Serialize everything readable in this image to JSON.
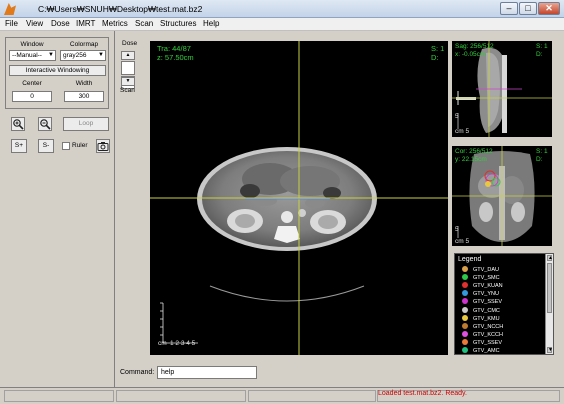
{
  "window": {
    "title": "C:₩Users₩SNUH₩Desktop₩test.mat.bz2",
    "minimize": "–",
    "maximize": "□",
    "close": "✕"
  },
  "menu": [
    "File",
    "View",
    "Dose",
    "IMRT",
    "Metrics",
    "Scan",
    "Structures",
    "Help"
  ],
  "left_panel": {
    "window_label": "Window",
    "colormap_label": "Colormap",
    "window_value": "--Manual--",
    "colormap_value": "gray256",
    "interactive_windowing": "Interactive Windowing",
    "center_label": "Center",
    "width_label": "Width",
    "center_value": "0",
    "width_value": "300",
    "loop_label": "Loop",
    "splus_label": "S+",
    "sminus_label": "S-",
    "ruler_label": "Ruler"
  },
  "dose_panel": {
    "dose_label": "Dose",
    "scan_label": "Scan"
  },
  "axial_view": {
    "line1": "Tra: 44/87",
    "line2": "z: 57.50cm",
    "right1": "S: 1",
    "right2": "D:",
    "scale_unit": "cm",
    "scale_ticks": "1 2 3 4 5"
  },
  "sagittal_view": {
    "line1": "Sag: 256/512",
    "line2": "x: -0.05cm",
    "right1": "S: 1",
    "right2": "D:",
    "scale_label": "5",
    "scale_unit": "cm 5"
  },
  "coronal_view": {
    "line1": "Cor: 256/512",
    "line2": "y: 22.15cm",
    "right1": "S: 1",
    "right2": "D:",
    "scale_label": "5",
    "scale_unit": "cm 5"
  },
  "legend": {
    "title": "Legend",
    "items": [
      {
        "label": "GTV_DAU",
        "color": "#d9a24a"
      },
      {
        "label": "GTV_SMC",
        "color": "#2ec94a"
      },
      {
        "label": "GTV_KUAN",
        "color": "#e03030"
      },
      {
        "label": "GTV_YNU",
        "color": "#3399dd"
      },
      {
        "label": "GTV_SSEV",
        "color": "#cc33cc"
      },
      {
        "label": "GTV_CMC",
        "color": "#c9c9c9"
      },
      {
        "label": "GTV_KMU",
        "color": "#e8c840"
      },
      {
        "label": "GTV_NCCH",
        "color": "#c07a30"
      },
      {
        "label": "GTV_KCCH",
        "color": "#e050e0"
      },
      {
        "label": "GTV_SSEV",
        "color": "#ea7a3a"
      },
      {
        "label": "GTV_AMC",
        "color": "#20c080"
      }
    ]
  },
  "command": {
    "label": "Command:",
    "value": "help"
  },
  "status": {
    "message": "Loaded test.mat.bz2.  Ready."
  }
}
